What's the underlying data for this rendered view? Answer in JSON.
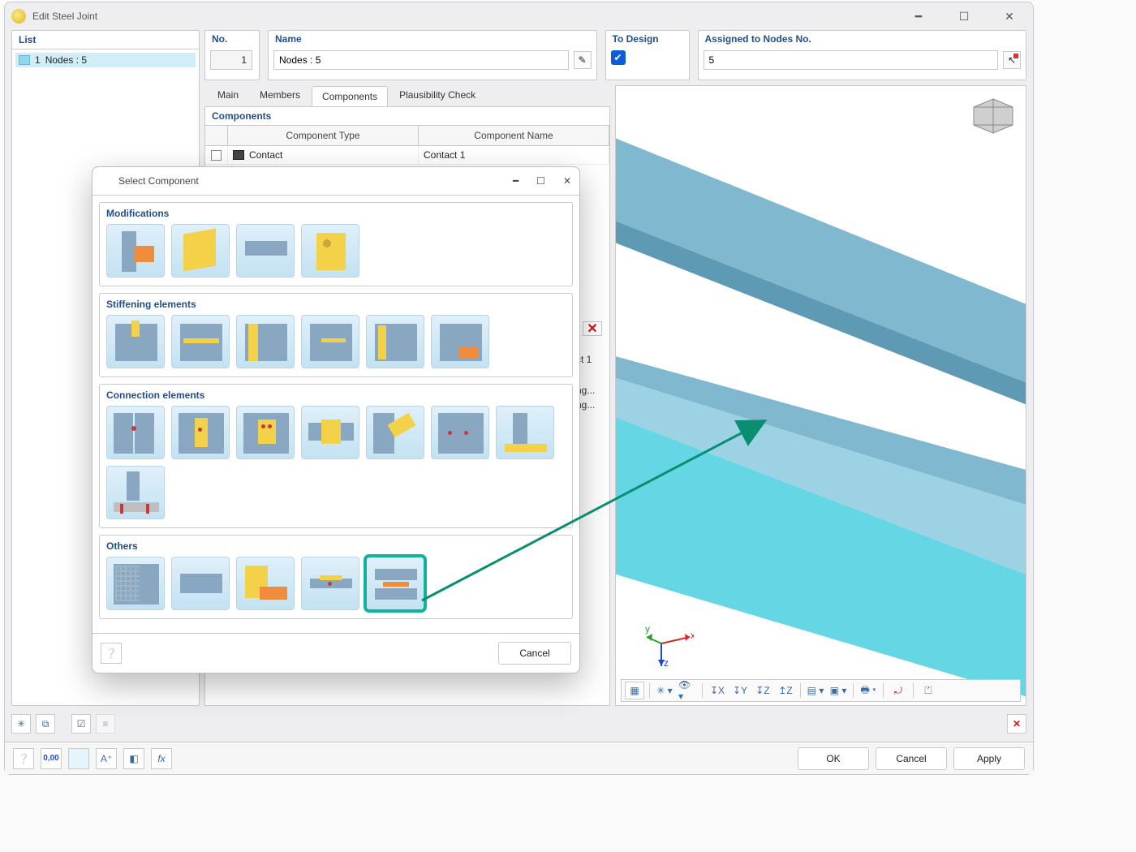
{
  "window": {
    "title": "Edit Steel Joint"
  },
  "left": {
    "heading": "List",
    "item_index": "1",
    "item_label": "Nodes : 5"
  },
  "fields": {
    "no": {
      "label": "No.",
      "value": "1"
    },
    "name": {
      "label": "Name",
      "value": "Nodes : 5"
    },
    "to_design": {
      "label": "To Design",
      "checked": true
    },
    "assigned": {
      "label": "Assigned to Nodes No.",
      "value": "5"
    }
  },
  "tabs": {
    "main": "Main",
    "members": "Members",
    "components": "Components",
    "plausibility": "Plausibility Check"
  },
  "components": {
    "heading": "Components",
    "col_type": "Component Type",
    "col_name": "Component Name",
    "row1_type": "Contact",
    "row1_name": "Contact 1",
    "side_label": "ct 1",
    "trunc1": "ng...",
    "trunc2": "ng..."
  },
  "dialog": {
    "title": "Select Component",
    "sections": {
      "modifications": "Modifications",
      "stiffening": "Stiffening elements",
      "connection": "Connection elements",
      "others": "Others"
    },
    "cancel": "Cancel"
  },
  "footer": {
    "ok": "OK",
    "cancel": "Cancel",
    "apply": "Apply"
  },
  "axis": {
    "x": "x",
    "y": "y",
    "z": "z"
  }
}
